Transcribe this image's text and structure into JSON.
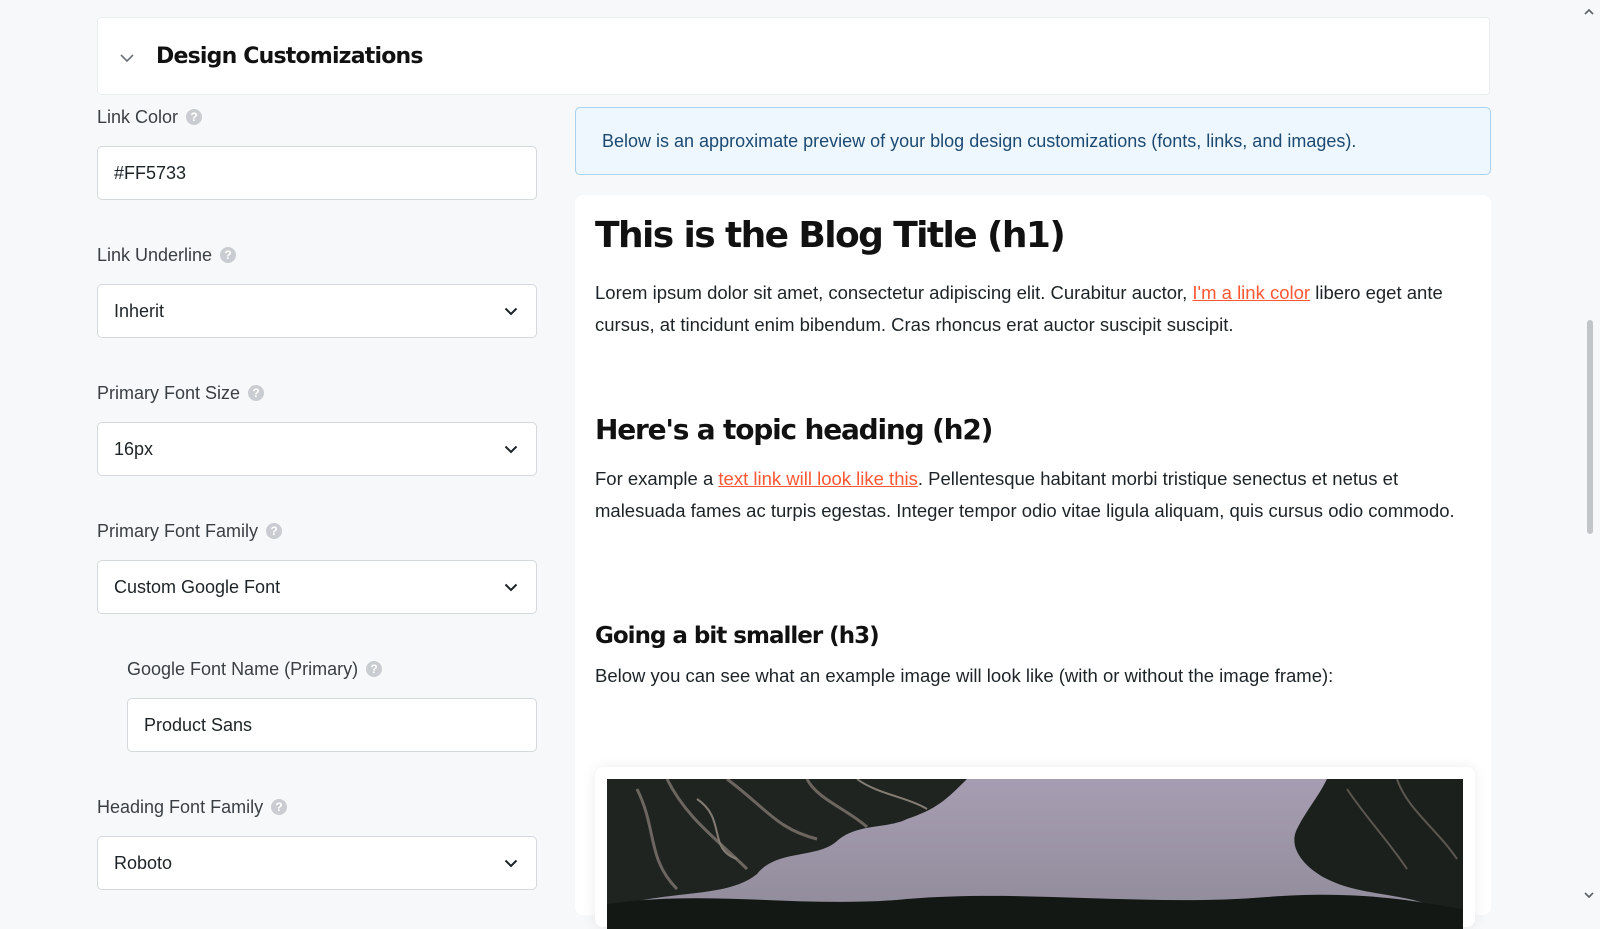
{
  "section": {
    "title": "Design Customizations",
    "toggle_icon": "chevron-down-icon"
  },
  "fields": {
    "link_color": {
      "label": "Link Color",
      "value": "#FF5733"
    },
    "link_underline": {
      "label": "Link Underline",
      "value": "Inherit"
    },
    "primary_font_size": {
      "label": "Primary Font Size",
      "value": "16px"
    },
    "primary_font_family": {
      "label": "Primary Font Family",
      "value": "Custom Google Font"
    },
    "google_font_name_primary": {
      "label": "Google Font Name (Primary)",
      "value": "Product Sans"
    },
    "heading_font_family": {
      "label": "Heading Font Family",
      "value": "Roboto"
    }
  },
  "help_glyph": "?",
  "notice": {
    "text": "Below is an approximate preview of your blog design customizations (fonts, links, and images)."
  },
  "preview": {
    "h1": "This is the Blog Title (h1)",
    "p1_before": "Lorem ipsum dolor sit amet, consectetur adipiscing elit. Curabitur auctor, ",
    "p1_link": "I'm a link color",
    "p1_after": " libero eget ante cursus, at tincidunt enim bibendum. Cras rhoncus erat auctor suscipit suscipit.",
    "h2": "Here's a topic heading (h2)",
    "p2_before": "For example a ",
    "p2_link": "text link will look like this",
    "p2_after": ". Pellentesque habitant morbi tristique senectus et netus et malesuada fames ac turpis egestas. Integer tempor odio vitae ligula aliquam, quis cursus odio commodo.",
    "h3": "Going a bit smaller (h3)",
    "p3": "Below you can see what an example image will look like (with or without the image frame):"
  },
  "colors": {
    "link": "#FF5733",
    "notice_bg": "#eef7fd",
    "notice_border": "#a7d3f0",
    "notice_text": "#1d4a73"
  }
}
